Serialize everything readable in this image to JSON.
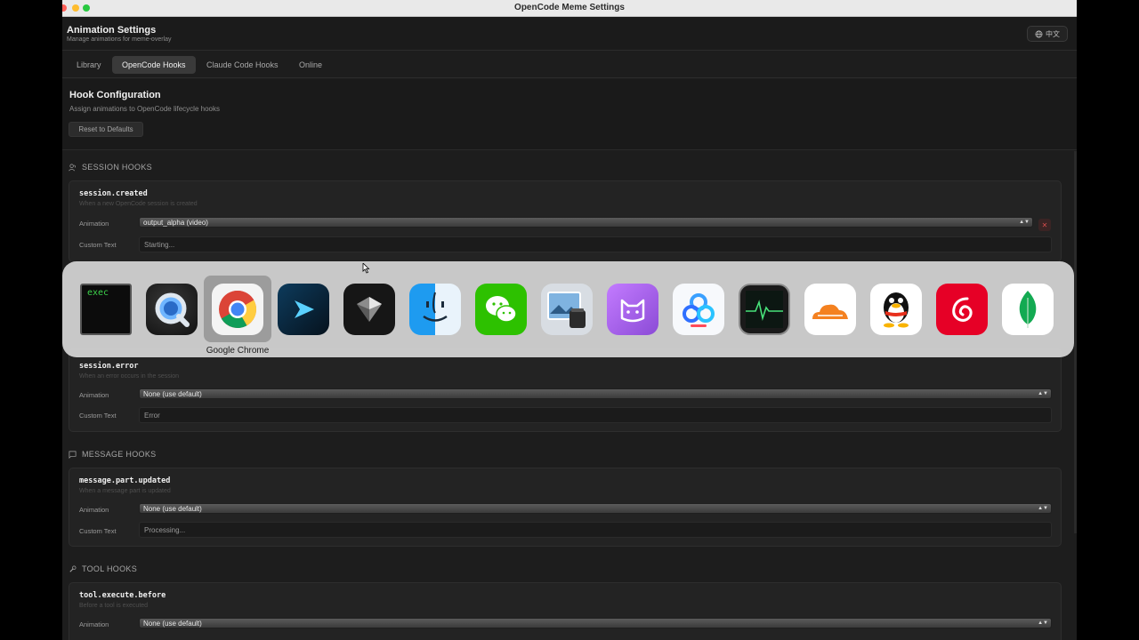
{
  "window": {
    "title": "OpenCode Meme Settings"
  },
  "header": {
    "title": "Animation Settings",
    "subtitle": "Manage animations for meme-overlay",
    "lang_button": "中文"
  },
  "tabs": [
    {
      "label": "Library",
      "active": false
    },
    {
      "label": "OpenCode Hooks",
      "active": true
    },
    {
      "label": "Claude Code Hooks",
      "active": false
    },
    {
      "label": "Online",
      "active": false
    }
  ],
  "hook_config": {
    "title": "Hook Configuration",
    "subtitle": "Assign animations to OpenCode lifecycle hooks",
    "reset_label": "Reset to Defaults"
  },
  "labels": {
    "animation": "Animation",
    "custom_text": "Custom Text"
  },
  "sections": {
    "session": "SESSION HOOKS",
    "message": "MESSAGE HOOKS",
    "tool": "TOOL HOOKS"
  },
  "hooks": {
    "session_created": {
      "name": "session.created",
      "description": "When a new OpenCode session is created",
      "animation": "output_alpha (video)",
      "custom_text": "Starting..."
    },
    "session_error": {
      "name": "session.error",
      "description": "When an error occurs in the session",
      "animation": "None (use default)",
      "custom_text": "Error"
    },
    "message_part_updated": {
      "name": "message.part.updated",
      "description": "When a message part is updated",
      "animation": "None (use default)",
      "custom_text": "Processing..."
    },
    "tool_execute_before": {
      "name": "tool.execute.before",
      "description": "Before a tool is executed",
      "animation": "None (use default)"
    }
  },
  "app_switcher": {
    "selected_label": "Google Chrome",
    "apps": [
      {
        "icon": "terminal-exec-icon",
        "text": "exec"
      },
      {
        "icon": "quicktime-icon"
      },
      {
        "icon": "google-chrome-icon",
        "selected": true
      },
      {
        "icon": "cursor-arrow-app-icon"
      },
      {
        "icon": "cube-app-icon"
      },
      {
        "icon": "finder-icon"
      },
      {
        "icon": "wechat-icon"
      },
      {
        "icon": "preview-icon"
      },
      {
        "icon": "cat-app-icon"
      },
      {
        "icon": "baidu-netdisk-icon"
      },
      {
        "icon": "activity-monitor-icon"
      },
      {
        "icon": "cloudflare-icon"
      },
      {
        "icon": "qq-penguin-icon"
      },
      {
        "icon": "netease-music-icon"
      },
      {
        "icon": "mongodb-icon"
      }
    ]
  },
  "colors": {
    "background": "#1d1d1d",
    "accent_active_tab": "#3a3a3a",
    "delete_red": "#d24b4b"
  }
}
